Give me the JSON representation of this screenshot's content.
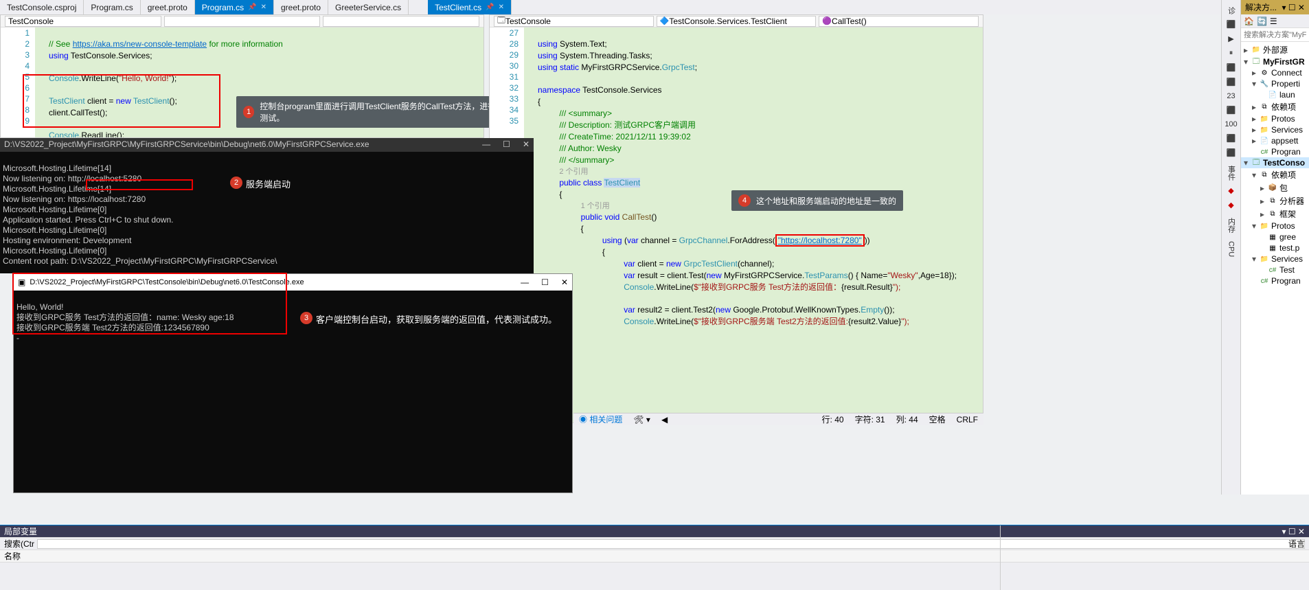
{
  "tabs": [
    {
      "label": "TestConsole.csproj"
    },
    {
      "label": "Program.cs"
    },
    {
      "label": "greet.proto"
    },
    {
      "label": "Program.cs",
      "active": true,
      "pin": true
    },
    {
      "label": "greet.proto"
    },
    {
      "label": "GreeterService.cs"
    },
    {
      "label": "TestClient.cs",
      "active": true,
      "pin": true
    }
  ],
  "left_ctx": {
    "proj": "TestConsole",
    "scope": "",
    "member": ""
  },
  "right_ctx": {
    "proj": "TestConsole",
    "scope": "TestConsole.Services.TestClient",
    "member": "CallTest()"
  },
  "left_lines": [
    "1",
    "2",
    "3",
    "4",
    "5",
    "6",
    "7",
    "8",
    "9"
  ],
  "left_code": {
    "l1a": "// See ",
    "l1b": "https://aka.ms/new-console-template",
    "l1c": " for more information",
    "l2a": "using",
    "l2b": " TestConsole.Services;",
    "l4a": "Console",
    "l4b": ".WriteLine(",
    "l4c": "\"Hello, World!\"",
    "l4d": ");",
    "l6a": "TestClient",
    "l6b": " client = ",
    "l6c": "new",
    "l6d": " TestClient",
    "l6e": "();",
    "l7a": "client.CallTest();",
    "l9a": "Console",
    "l9b": ".ReadLine();"
  },
  "right_lines": [
    "27",
    "28",
    "29",
    "30",
    "31",
    "32",
    "33",
    "34",
    "35"
  ],
  "right_code": {
    "r27a": "using",
    "r27b": " System.Text;",
    "r28a": "using",
    "r28b": " System.Threading.Tasks;",
    "r29a": "using static",
    "r29b": " MyFirstGRPCService.",
    "r29c": "GrpcTest",
    "r29d": ";",
    "r31a": "namespace",
    "r31b": " TestConsole.Services",
    "r32": "{",
    "rsum1": "/// <summary>",
    "rsum2": "/// Description: 测试GRPC客户端调用",
    "rsum3": "/// CreateTime: 2021/12/11 19:39:02",
    "rsum4": "/// Author: Wesky",
    "rsum5": "/// </summary>",
    "rref1": "2 个引用",
    "rcls1": "public class ",
    "rcls2": "TestClient",
    "rob": "{",
    "rref2": "1 个引用",
    "rm1": "public void ",
    "rm2": "CallTest",
    "rm3": "()",
    "rob2": "{",
    "ru1": "using",
    "ru2": " (",
    "ru3": "var",
    "ru4": " channel = ",
    "ru5": "GrpcChannel",
    "ru6": ".ForAddress(",
    "ru7": "\"https://localhost:7280\"",
    "ru8": "))",
    "rob3": "{",
    "rc1": "var",
    "rc2": " client = ",
    "rc3": "new",
    "rc4": " GrpcTestClient",
    "rc5": "(channel);",
    "rr1": "var",
    "rr2": " result = client.Test(",
    "rr3": "new",
    "rr4": " MyFirstGRPCService.",
    "rr5": "TestParams",
    "rr6": "() { Name=",
    "rr7": "\"Wesky\"",
    "rr8": ",Age=18});",
    "rw1": "Console",
    "rw2": ".WriteLine(",
    "rw3": "$\"接收到GRPC服务 Test方法的返回值：",
    "rw4": "{result.Result}",
    "rw5": "\");",
    "rr21": "var",
    "rr22": " result2 = client.Test2(",
    "rr23": "new",
    "rr24": " Google.Protobuf.WellKnownTypes.",
    "rr25": "Empty",
    "rr26": "());",
    "rw21": "Console",
    "rw22": ".WriteLine(",
    "rw23": "$\"接收到GRPC服务端 Test2方法的返回值:",
    "rw24": "{result2.Value}",
    "rw25": "\");"
  },
  "callouts": {
    "c1": "控制台program里面进行调用TestClient服务的CallTest方法，进行测试。",
    "c2": "服务端启动",
    "c3": "客户端控制台启动，获取到服务端的返回值，代表测试成功。",
    "c4": "这个地址和服务端启动的地址是一致的"
  },
  "console1": {
    "title": "D:\\VS2022_Project\\MyFirstGRPC\\MyFirstGRPCService\\bin\\Debug\\net6.0\\MyFirstGRPCService.exe",
    "lines": [
      "Microsoft.Hosting.Lifetime[14]",
      "Now listening on: http://localhost:5280",
      "Microsoft.Hosting.Lifetime[14]",
      "Now listening on: https://localhost:7280",
      "Microsoft.Hosting.Lifetime[0]",
      "Application started. Press Ctrl+C to shut down.",
      "Microsoft.Hosting.Lifetime[0]",
      "Hosting environment: Development",
      "Microsoft.Hosting.Lifetime[0]",
      "Content root path: D:\\VS2022_Project\\MyFirstGRPC\\MyFirstGRPCService\\"
    ]
  },
  "console2": {
    "title": "D:\\VS2022_Project\\MyFirstGRPC\\TestConsole\\bin\\Debug\\net6.0\\TestConsole.exe",
    "lines": [
      "Hello, World!",
      "接收到GRPC服务 Test方法的返回值：name: Wesky age:18",
      "接收到GRPC服务端 Test2方法的返回值:1234567890",
      "-"
    ]
  },
  "statusbar": {
    "issue": "相关问题",
    "ln": "行: 40",
    "col": "字符: 31",
    "ch": "列: 44",
    "ins": "空格",
    "crlf": "CRLF"
  },
  "se": {
    "title": "解决方...",
    "search_ph": "搜索解决方案\"MyFi",
    "tree": [
      {
        "d": 0,
        "exp": "▸",
        "ico": "📁",
        "lbl": "外部源",
        "cls": "fold"
      },
      {
        "d": 0,
        "exp": "▾",
        "ico": "🗔",
        "lbl": "MyFirstGR",
        "cls": "proj",
        "bold": true
      },
      {
        "d": 1,
        "exp": "▸",
        "ico": "⚙",
        "lbl": "Connect"
      },
      {
        "d": 1,
        "exp": "▾",
        "ico": "🔧",
        "lbl": "Properti"
      },
      {
        "d": 2,
        "exp": "",
        "ico": "📄",
        "lbl": "laun"
      },
      {
        "d": 1,
        "exp": "▸",
        "ico": "⧉",
        "lbl": "依赖项"
      },
      {
        "d": 1,
        "exp": "▸",
        "ico": "📁",
        "lbl": "Protos",
        "cls": "fold"
      },
      {
        "d": 1,
        "exp": "▸",
        "ico": "📁",
        "lbl": "Services",
        "cls": "fold"
      },
      {
        "d": 1,
        "exp": "▸",
        "ico": "📄",
        "lbl": "appsett"
      },
      {
        "d": 1,
        "exp": "",
        "ico": "c#",
        "lbl": "Progran",
        "cls": "cs"
      },
      {
        "d": 0,
        "exp": "▾",
        "ico": "🗔",
        "lbl": "TestConso",
        "cls": "proj",
        "bold": true,
        "sel": true
      },
      {
        "d": 1,
        "exp": "▾",
        "ico": "⧉",
        "lbl": "依赖项"
      },
      {
        "d": 2,
        "exp": "▸",
        "ico": "📦",
        "lbl": "包"
      },
      {
        "d": 2,
        "exp": "▸",
        "ico": "⧉",
        "lbl": "分析器"
      },
      {
        "d": 2,
        "exp": "▸",
        "ico": "⧉",
        "lbl": "框架"
      },
      {
        "d": 1,
        "exp": "▾",
        "ico": "📁",
        "lbl": "Protos",
        "cls": "fold"
      },
      {
        "d": 2,
        "exp": "",
        "ico": "▦",
        "lbl": "gree"
      },
      {
        "d": 2,
        "exp": "",
        "ico": "▦",
        "lbl": "test.p"
      },
      {
        "d": 1,
        "exp": "▾",
        "ico": "📁",
        "lbl": "Services",
        "cls": "fold"
      },
      {
        "d": 2,
        "exp": "",
        "ico": "c#",
        "lbl": "Test",
        "cls": "cs"
      },
      {
        "d": 1,
        "exp": "",
        "ico": "c#",
        "lbl": "Progran",
        "cls": "cs"
      }
    ]
  },
  "rstrip": [
    "诊",
    "⬛",
    "▶",
    "⏸",
    "⬛",
    "⬛",
    "23",
    "⬛",
    "100",
    "⬛",
    "⬛",
    "事件",
    "◆",
    "◆",
    "内存",
    "CPU"
  ],
  "bottom": {
    "tab1": "局部变量",
    "search": "搜索(Ctr",
    "col1": "名称",
    "right_title": "",
    "right_col": "语言"
  },
  "wbtns": {
    "min": "—",
    "max": "☐",
    "close": "✕"
  }
}
